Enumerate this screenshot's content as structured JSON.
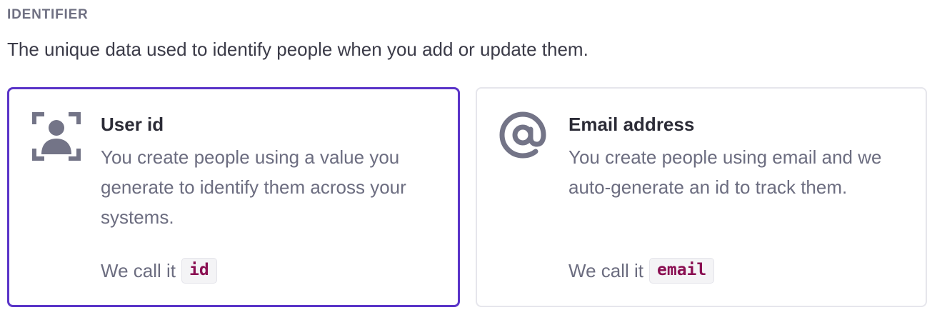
{
  "section": {
    "label": "IDENTIFIER",
    "description": "The unique data used to identify people when you add or update them."
  },
  "options": [
    {
      "title": "User id",
      "description": "You create people using a value you generate to identify them across your systems.",
      "call_prefix": "We call it",
      "code": "id",
      "icon": "user-id-icon",
      "selected": true
    },
    {
      "title": "Email address",
      "description": "You create people using email and we auto-generate an id to track them.",
      "call_prefix": "We call it",
      "code": "email",
      "icon": "at-sign-icon",
      "selected": false
    }
  ],
  "colors": {
    "selected_border": "#5a34c8",
    "icon": "#737487",
    "code_text": "#8a0f52"
  }
}
